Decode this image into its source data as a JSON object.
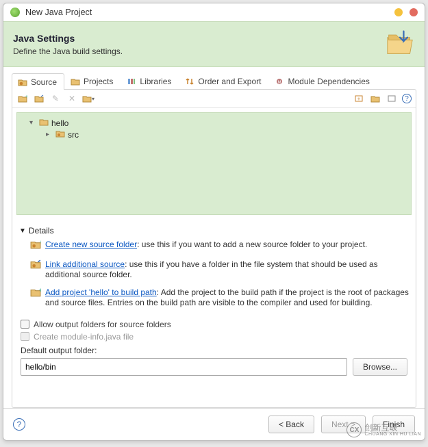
{
  "window": {
    "title": "New Java Project"
  },
  "header": {
    "title": "Java Settings",
    "subtitle": "Define the Java build settings."
  },
  "tabs": [
    {
      "label": "Source"
    },
    {
      "label": "Projects"
    },
    {
      "label": "Libraries"
    },
    {
      "label": "Order and Export"
    },
    {
      "label": "Module Dependencies"
    }
  ],
  "tree": {
    "project": "hello",
    "folder": "src"
  },
  "details": {
    "heading": "Details",
    "items": [
      {
        "link": "Create new source folder",
        "rest": ": use this if you want to add a new source folder to your project."
      },
      {
        "link": "Link additional source",
        "rest": ": use this if you have a folder in the file system that should be used as additional source folder."
      },
      {
        "link": "Add project 'hello' to build path",
        "rest": ": Add the project to the build path if the project is the root of packages and source files. Entries on the build path are visible to the compiler and used for building."
      }
    ]
  },
  "checks": {
    "allow_output": "Allow output folders for source folders",
    "create_module": "Create module-info.java file"
  },
  "output": {
    "label": "Default output folder:",
    "value": "hello/bin",
    "browse": "Browse..."
  },
  "buttons": {
    "back": "< Back",
    "next": "Next >",
    "finish": "Finish"
  },
  "watermark": {
    "brand": "创新互联",
    "sub": "CHUANG XIN HU LIAN"
  }
}
